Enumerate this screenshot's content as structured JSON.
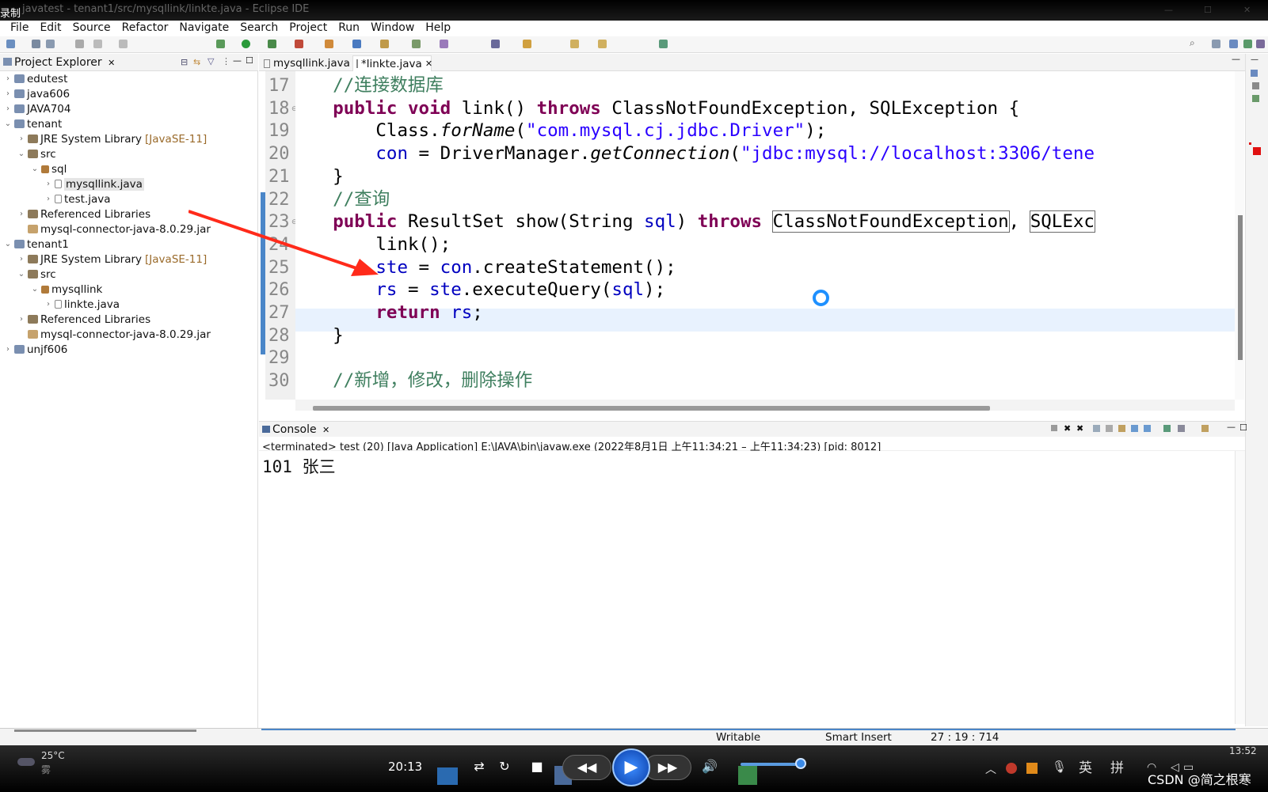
{
  "window": {
    "recording_label": "录制",
    "title": "javatest - tenant1/src/mysqllink/linkte.java - Eclipse IDE"
  },
  "menu": [
    "File",
    "Edit",
    "Source",
    "Refactor",
    "Navigate",
    "Search",
    "Project",
    "Run",
    "Window",
    "Help"
  ],
  "project_explorer": {
    "title": "Project Explorer",
    "tree": [
      {
        "label": "edutest",
        "icon": "project-icon",
        "level": 0,
        "twisty": "›"
      },
      {
        "label": "java606",
        "icon": "project-icon",
        "level": 0,
        "twisty": "›"
      },
      {
        "label": "JAVA704",
        "icon": "project-icon",
        "level": 0,
        "twisty": "›"
      },
      {
        "label": "tenant",
        "icon": "project-icon",
        "level": 0,
        "twisty": "⌄"
      },
      {
        "label": "JRE System Library",
        "decoration": "[JavaSE-11]",
        "icon": "library-icon",
        "level": 1,
        "twisty": "›"
      },
      {
        "label": "src",
        "icon": "package-folder-icon",
        "level": 1,
        "twisty": "⌄"
      },
      {
        "label": "sql",
        "icon": "package-icon",
        "level": 2,
        "twisty": "⌄"
      },
      {
        "label": "mysqllink.java",
        "icon": "java-file-icon",
        "level": 3,
        "twisty": "›",
        "selected": true
      },
      {
        "label": "test.java",
        "icon": "java-file-icon",
        "level": 3,
        "twisty": "›"
      },
      {
        "label": "Referenced Libraries",
        "icon": "library-icon",
        "level": 1,
        "twisty": "›"
      },
      {
        "label": "mysql-connector-java-8.0.29.jar",
        "icon": "jar-icon",
        "level": 1,
        "twisty": ""
      },
      {
        "label": "tenant1",
        "icon": "project-icon",
        "level": 0,
        "twisty": "⌄"
      },
      {
        "label": "JRE System Library",
        "decoration": "[JavaSE-11]",
        "icon": "library-icon",
        "level": 1,
        "twisty": "›"
      },
      {
        "label": "src",
        "icon": "package-folder-icon",
        "level": 1,
        "twisty": "⌄"
      },
      {
        "label": "mysqllink",
        "icon": "package-icon",
        "level": 2,
        "twisty": "⌄"
      },
      {
        "label": "linkte.java",
        "icon": "java-file-icon",
        "level": 3,
        "twisty": "›"
      },
      {
        "label": "Referenced Libraries",
        "icon": "library-icon",
        "level": 1,
        "twisty": "›"
      },
      {
        "label": "mysql-connector-java-8.0.29.jar",
        "icon": "jar-icon",
        "level": 1,
        "twisty": ""
      },
      {
        "label": "unjf606",
        "icon": "project-icon",
        "level": 0,
        "twisty": "›"
      }
    ]
  },
  "editor": {
    "tabs": [
      {
        "label": "mysqllink.java",
        "active": false
      },
      {
        "label": "*linkte.java",
        "active": true
      }
    ],
    "line_numbers": [
      "17",
      "18",
      "19",
      "20",
      "21",
      "22",
      "23",
      "24",
      "25",
      "26",
      "27",
      "28",
      "29",
      "30"
    ],
    "code": [
      [
        {
          "t": "    //连接数据库",
          "c": "cm"
        }
      ],
      [
        {
          "t": "    ",
          "c": ""
        },
        {
          "t": "public",
          "c": "kw"
        },
        {
          "t": " ",
          "c": ""
        },
        {
          "t": "void",
          "c": "kw"
        },
        {
          "t": " link() ",
          "c": ""
        },
        {
          "t": "throws",
          "c": "kw"
        },
        {
          "t": " ClassNotFoundException, SQLException {",
          "c": ""
        }
      ],
      [
        {
          "t": "        Class.",
          "c": ""
        },
        {
          "t": "forName",
          "c": "it"
        },
        {
          "t": "(",
          "c": ""
        },
        {
          "t": "\"com.mysql.cj.jdbc.Driver\"",
          "c": "st"
        },
        {
          "t": ");",
          "c": ""
        }
      ],
      [
        {
          "t": "        ",
          "c": ""
        },
        {
          "t": "con",
          "c": "fd"
        },
        {
          "t": " = DriverManager.",
          "c": ""
        },
        {
          "t": "getConnection",
          "c": "it"
        },
        {
          "t": "(",
          "c": ""
        },
        {
          "t": "\"jdbc:mysql://localhost:3306/tene",
          "c": "st"
        }
      ],
      [
        {
          "t": "    }",
          "c": ""
        }
      ],
      [
        {
          "t": "    //查询",
          "c": "cm"
        }
      ],
      [
        {
          "t": "    ",
          "c": ""
        },
        {
          "t": "public",
          "c": "kw"
        },
        {
          "t": " ResultSet show(String ",
          "c": ""
        },
        {
          "t": "sql",
          "c": "fd"
        },
        {
          "t": ") ",
          "c": ""
        },
        {
          "t": "throws",
          "c": "kw"
        },
        {
          "t": " ",
          "c": ""
        },
        {
          "t": "ClassNotFoundException",
          "c": "boxed"
        },
        {
          "t": ", ",
          "c": ""
        },
        {
          "t": "SQLExc",
          "c": "boxed"
        }
      ],
      [
        {
          "t": "        link();",
          "c": ""
        }
      ],
      [
        {
          "t": "        ",
          "c": ""
        },
        {
          "t": "ste",
          "c": "fd"
        },
        {
          "t": " = ",
          "c": ""
        },
        {
          "t": "con",
          "c": "fd"
        },
        {
          "t": ".createStatement();",
          "c": ""
        }
      ],
      [
        {
          "t": "        ",
          "c": ""
        },
        {
          "t": "rs",
          "c": "fd"
        },
        {
          "t": " = ",
          "c": ""
        },
        {
          "t": "ste",
          "c": "fd"
        },
        {
          "t": ".executeQuery(",
          "c": ""
        },
        {
          "t": "sql",
          "c": "fd"
        },
        {
          "t": ");",
          "c": ""
        }
      ],
      [
        {
          "t": "        ",
          "c": ""
        },
        {
          "t": "return",
          "c": "kw"
        },
        {
          "t": " ",
          "c": ""
        },
        {
          "t": "rs",
          "c": "fd"
        },
        {
          "t": ";",
          "c": ""
        }
      ],
      [
        {
          "t": "    }",
          "c": ""
        }
      ],
      [
        {
          "t": "",
          "c": ""
        }
      ],
      [
        {
          "t": "    //新增，修改，删除操作",
          "c": "cm"
        }
      ]
    ]
  },
  "console": {
    "title": "Console",
    "status": "<terminated> test (20) [Java Application] E:\\JAVA\\bin\\javaw.exe  (2022年8月1日 上午11:34:21 – 上午11:34:23) [pid: 8012]",
    "output": "101 张三"
  },
  "statusbar": {
    "mode": "Writable",
    "insert": "Smart Insert",
    "position": "27 : 19 : 714"
  },
  "taskbar": {
    "weather_temp": "25°C",
    "weather_desc": "雾",
    "player_time": "20:13",
    "ime_lang": "英",
    "ime_mode": "拼",
    "clock": "13:52",
    "watermark": "CSDN @简之根寒"
  },
  "colors": {
    "keyword": "#7f0055",
    "string": "#2a00ff",
    "field": "#0000c0",
    "comment": "#3f7f5f",
    "current_line": "#e8f2fe",
    "arrow": "#ff2a1a"
  }
}
